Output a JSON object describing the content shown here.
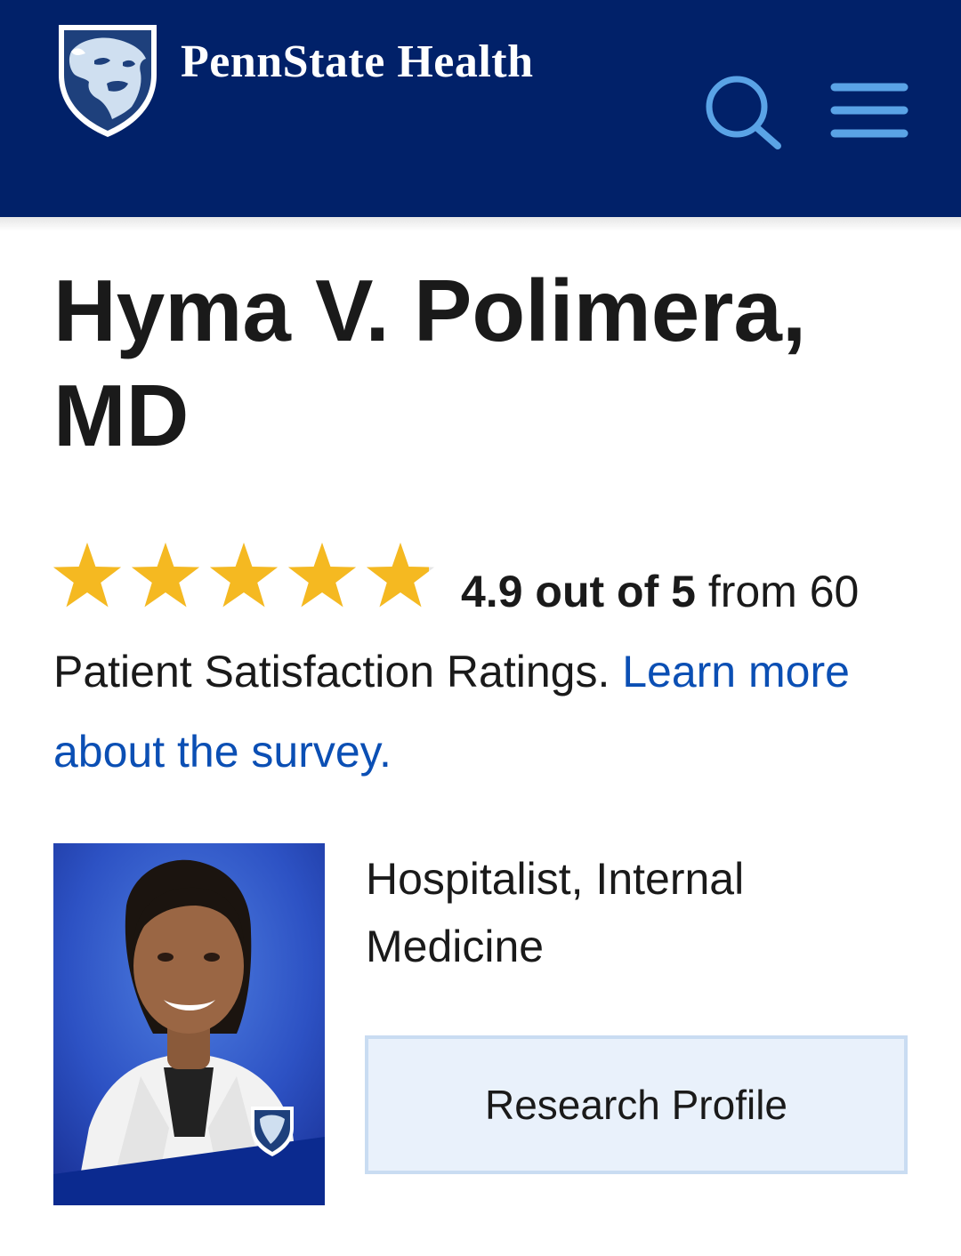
{
  "header": {
    "brand": "PennState Health",
    "logo_icon": "nittany-lion-shield-icon",
    "search_icon": "search-icon",
    "menu_icon": "hamburger-menu-icon",
    "background_color": "#012169",
    "icon_color": "#5aa3e6"
  },
  "profile": {
    "name": "Hyma V. Polimera, MD",
    "rating": {
      "value": 4.9,
      "max": 5,
      "stars_filled": 4.9,
      "score_text": "4.9 out of 5",
      "count_text": " from 60 Patient Satisfaction Ratings. ",
      "link_text": "Learn more about the survey.",
      "star_color": "#f5b921"
    },
    "photo": {
      "badge_icon": "nittany-lion-shield-icon"
    },
    "specialty": "Hospitalist, Internal Medicine",
    "research_button": "Research Profile"
  }
}
